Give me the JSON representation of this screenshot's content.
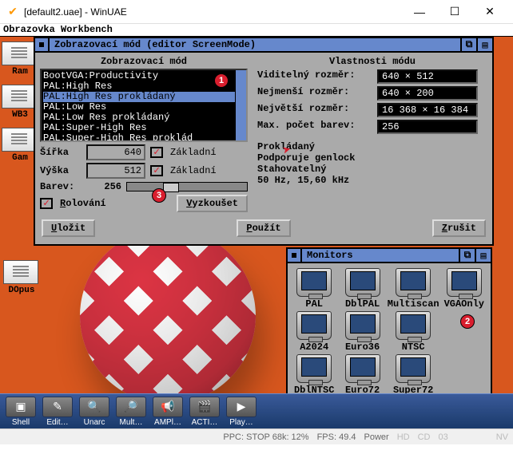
{
  "window": {
    "title": "[default2.uae] - WinUAE"
  },
  "workbench": {
    "header": "Obrazovka Workbench"
  },
  "screenmode": {
    "title": "Zobrazovací mód (editor ScreenMode)",
    "group_left": "Zobrazovací mód",
    "group_right": "Vlastnosti módu",
    "modes": [
      "BootVGA:Productivity",
      "PAL:High Res",
      "PAL:High Res prokládaný",
      "PAL:Low Res",
      "PAL:Low Res prokládaný",
      "PAL:Super-High Res",
      "PAL:Super-High Res proklád"
    ],
    "selected_mode_index": 2,
    "width_label": "Šířka",
    "width": "640",
    "height_label": "Výška",
    "height": "512",
    "basic_label": "Základní",
    "colors_label": "Barev:",
    "colors": "256",
    "scroll_label": "Rolování",
    "try_btn": "Vyzkoušet",
    "save_btn": "Uložit",
    "use_btn": "Použít",
    "cancel_btn": "Zrušit",
    "prop_visible": "Viditelný rozměr:",
    "prop_visible_val": "640 × 512",
    "prop_min": "Nejmenší rozměr:",
    "prop_min_val": "640 × 200",
    "prop_max": "Největší rozměr:",
    "prop_max_val": "16 368 × 16 384",
    "prop_maxcolors": "Max. počet barev:",
    "prop_maxcolors_val": "256",
    "feat1": "Prokládaný",
    "feat2": "Podporuje genlock",
    "feat3": "Stahovatelný",
    "feat4": "50 Hz, 15,60 kHz"
  },
  "monitors": {
    "title": "Monitors",
    "items": [
      "PAL",
      "DblPAL",
      "Multiscan",
      "VGAOnly",
      "A2024",
      "Euro36",
      "NTSC",
      "",
      "DblNTSC",
      "Euro72",
      "Super72",
      ""
    ]
  },
  "desktop_icons": {
    "ram": "Ram",
    "wb3": "WB3",
    "games": "Gam",
    "dopus": "DOpus"
  },
  "dock": {
    "items": [
      "Shell",
      "Edit…",
      "Unarc",
      "Mult…",
      "AMPl…",
      "ACTI…",
      "Play…"
    ]
  },
  "badges": {
    "b1": "1",
    "b2": "2",
    "b3": "3"
  },
  "statusbar": {
    "ppc": "PPC: STOP 68k: 12%",
    "fps": "FPS: 49.4",
    "power": "Power",
    "hd": "HD",
    "cd": "CD",
    "num": "03",
    "nv": "NV"
  }
}
